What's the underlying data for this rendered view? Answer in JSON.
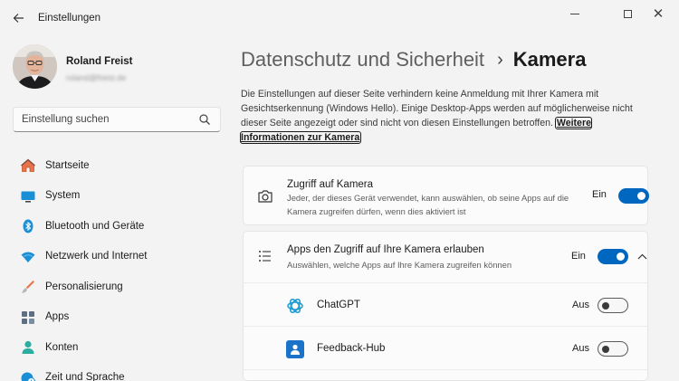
{
  "window": {
    "title": "Einstellungen",
    "back_icon": "arrow-left-icon",
    "controls": [
      "minimize-icon",
      "maximize-icon",
      "close-icon"
    ]
  },
  "profile": {
    "name": "Roland Freist",
    "email": "roland@freist.de"
  },
  "search": {
    "placeholder": "Einstellung suchen",
    "icon": "search-icon"
  },
  "sidebar": {
    "items": [
      {
        "label": "Startseite",
        "icon": "home-icon"
      },
      {
        "label": "System",
        "icon": "monitor-icon"
      },
      {
        "label": "Bluetooth und Geräte",
        "icon": "bluetooth-icon"
      },
      {
        "label": "Netzwerk und Internet",
        "icon": "wifi-icon"
      },
      {
        "label": "Personalisierung",
        "icon": "brush-icon"
      },
      {
        "label": "Apps",
        "icon": "apps-icon"
      },
      {
        "label": "Konten",
        "icon": "person-icon"
      },
      {
        "label": "Zeit und Sprache",
        "icon": "globe-clock-icon"
      }
    ]
  },
  "main": {
    "breadcrumb": {
      "parent": "Datenschutz und Sicherheit",
      "separator": "›",
      "current": "Kamera"
    },
    "description": "Die Einstellungen auf dieser Seite verhindern keine Anmeldung mit Ihrer Kamera mit Gesichtserkennung (Windows Hello). Einige Desktop-Apps werden auf möglicherweise nicht dieser Seite angezeigt oder sind nicht von diesen Einstellungen betroffen.",
    "more_link": "Weitere Informationen zur Kamera",
    "camera_access": {
      "title": "Zugriff auf Kamera",
      "subtitle": "Jeder, der dieses Gerät verwendet, kann auswählen, ob seine Apps auf die Kamera zugreifen dürfen, wenn dies aktiviert ist",
      "state": "Ein",
      "on": true,
      "icon": "camera-icon"
    },
    "apps_access": {
      "title": "Apps den Zugriff auf Ihre Kamera erlauben",
      "subtitle": "Auswählen, welche Apps auf Ihre Kamera zugreifen können",
      "state": "Ein",
      "on": true,
      "icon": "list-icon",
      "expanded": true
    },
    "apps": [
      {
        "name": "ChatGPT",
        "state": "Aus",
        "on": false,
        "icon": "chatgpt-icon"
      },
      {
        "name": "Feedback-Hub",
        "state": "Aus",
        "on": false,
        "icon": "feedback-hub-icon"
      }
    ]
  },
  "colors": {
    "accent": "#0067c0",
    "background": "#f3f3f3",
    "card": "#fbfbfb"
  }
}
